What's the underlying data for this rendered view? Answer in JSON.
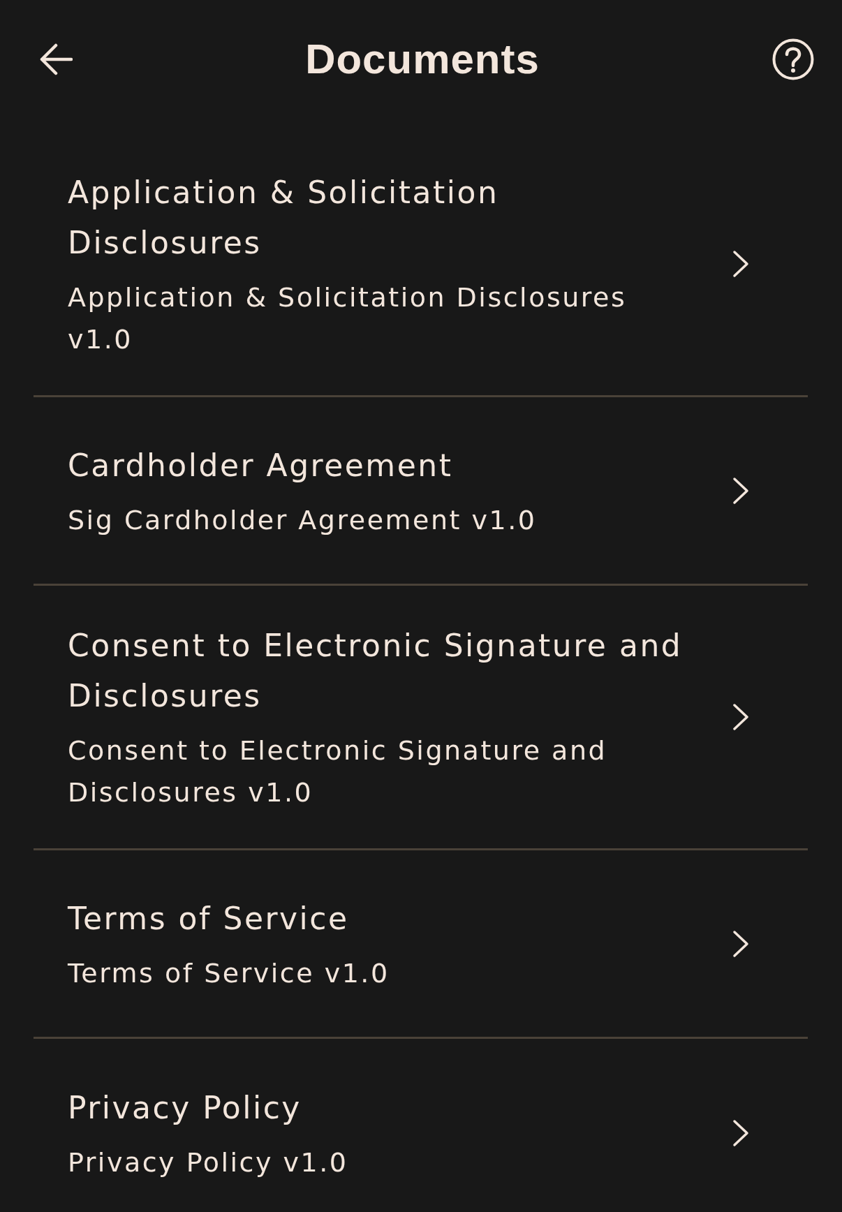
{
  "header": {
    "title": "Documents"
  },
  "documents": [
    {
      "title": "Application & Solicitation Disclosures",
      "version": "Application & Solicitation Disclosures v1.0"
    },
    {
      "title": "Cardholder Agreement",
      "version": "Sig Cardholder Agreement v1.0"
    },
    {
      "title": "Consent to Electronic Signature and Disclosures",
      "version": "Consent to Electronic Signature and Disclosures v1.0"
    },
    {
      "title": "Terms of Service",
      "version": "Terms of Service v1.0"
    },
    {
      "title": "Privacy Policy",
      "version": "Privacy Policy v1.0"
    }
  ]
}
